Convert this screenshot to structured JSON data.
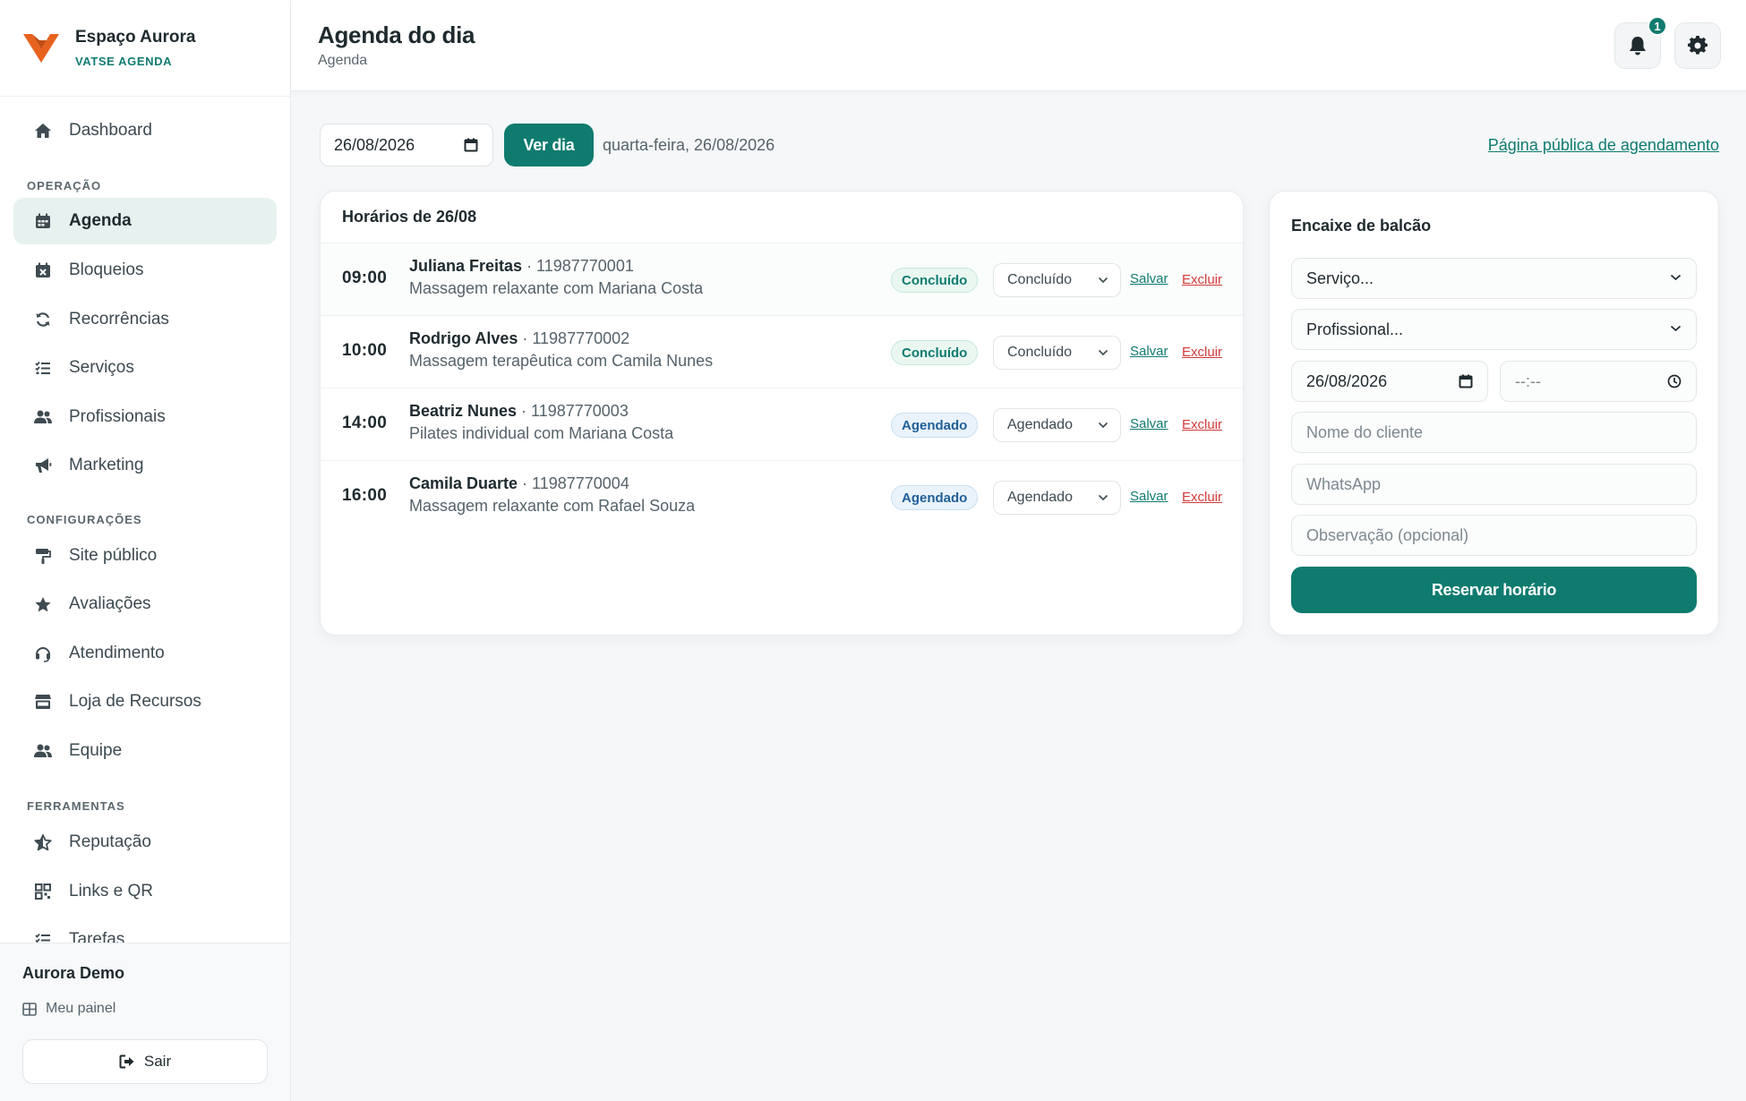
{
  "brand": {
    "name": "Espaço Aurora",
    "subtitle": "VATSE AGENDA"
  },
  "sidebar": {
    "dashboard": "Dashboard",
    "sections": {
      "operacao": "OPERAÇÃO",
      "configuracoes": "CONFIGURAÇÕES",
      "ferramentas": "FERRAMENTAS"
    },
    "operacao": [
      "Agenda",
      "Bloqueios",
      "Recorrências",
      "Serviços",
      "Profissionais",
      "Marketing"
    ],
    "configuracoes": [
      "Site público",
      "Avaliações",
      "Atendimento",
      "Loja de Recursos",
      "Equipe"
    ],
    "ferramentas": [
      "Reputação",
      "Links e QR",
      "Tarefas"
    ],
    "active": "Agenda"
  },
  "user": {
    "name": "Aurora Demo",
    "panel": "Meu painel",
    "logout": "Sair"
  },
  "header": {
    "title": "Agenda do dia",
    "breadcrumb": "Agenda",
    "notifications": "1"
  },
  "toolbar": {
    "date": "26/08/2026",
    "view_day": "Ver dia",
    "day_label": "quarta-feira, 26/08/2026",
    "public_link": "Página pública de agendamento"
  },
  "schedule": {
    "title": "Horários de 26/08",
    "save_label": "Salvar",
    "delete_label": "Excluir",
    "rows": [
      {
        "time": "09:00",
        "client": "Juliana Freitas",
        "phone": " · 11987770001",
        "service": "Massagem relaxante com Mariana Costa",
        "status": "Concluído",
        "select": "Concluído"
      },
      {
        "time": "10:00",
        "client": "Rodrigo Alves",
        "phone": " · 11987770002",
        "service": "Massagem terapêutica com Camila Nunes",
        "status": "Concluído",
        "select": "Concluído"
      },
      {
        "time": "14:00",
        "client": "Beatriz Nunes",
        "phone": " · 11987770003",
        "service": "Pilates individual com Mariana Costa",
        "status": "Agendado",
        "select": "Agendado"
      },
      {
        "time": "16:00",
        "client": "Camila Duarte",
        "phone": " · 11987770004",
        "service": "Massagem relaxante com Rafael Souza",
        "status": "Agendado",
        "select": "Agendado"
      }
    ]
  },
  "walkin": {
    "title": "Encaixe de balcão",
    "service": "Serviço...",
    "professional": "Profissional...",
    "date": "26/08/2026",
    "time": "--:--",
    "client_placeholder": "Nome do cliente",
    "whatsapp_placeholder": "WhatsApp",
    "note_placeholder": "Observação (opcional)",
    "submit": "Reservar horário"
  },
  "colors": {
    "accent": "#0f7b6f",
    "danger": "#d23a3a",
    "info": "#1f5f99",
    "brand_orange": "#e8621f"
  }
}
